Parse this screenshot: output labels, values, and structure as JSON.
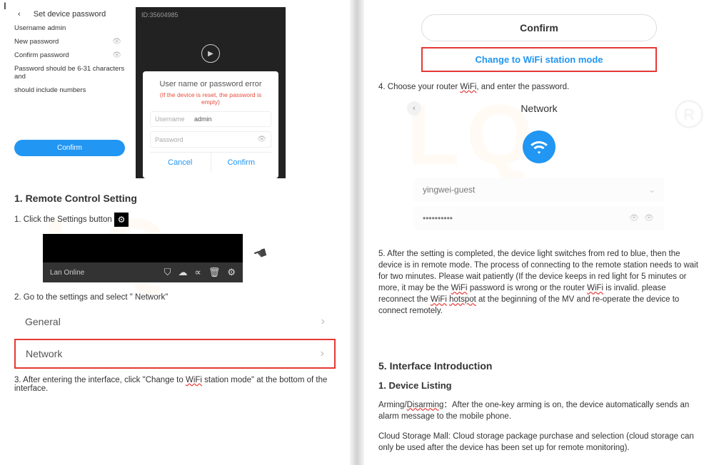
{
  "left": {
    "set_password_header": "Set device password",
    "username_admin": "Username admin",
    "new_password": "New password",
    "confirm_password": "Confirm password",
    "hint1": "Password should be 6-31 characters and",
    "hint2": "should include numbers",
    "confirm_btn": "Confirm",
    "id_label": "ID:35604985",
    "dialog_title": "User name or password error",
    "dialog_sub": "(If the device is reset, the password is empty)",
    "username_label": "Username",
    "username_value": "admin",
    "password_label": "Password",
    "cancel": "Cancel",
    "dlg_confirm": "Confirm",
    "section1": "1.  Remote Control Setting",
    "step1a": "1. Click the Settings button",
    "lan_online": "Lan  Online",
    "step2": "2. Go to the settings    and select \" Network\"",
    "menu_general": "General",
    "menu_network": "Network",
    "step3a": "3.   After entering the interface, click \"Change to ",
    "step3_wifi": "WiFi",
    "step3b": " station mode\" at the bottom of the interface."
  },
  "right": {
    "confirm_btn": "Confirm",
    "change_mode": "Change to WiFi station mode",
    "step4a": "4.    Choose your router ",
    "step4_wifi": "WiFi",
    "step4b": ", and enter the password.",
    "network_header": "Network",
    "ssid": "yingwei-guest",
    "dots": "••••••••••",
    "para5a": "5. After the setting is completed, the device light switches from red to blue, then the device is in remote mode. The process of connecting to the remote station needs to wait for two minutes. Please wait patiently (If the device keeps in red light for 5 minutes or more, it may be the ",
    "wifi1": "WiFi",
    "para5b": " password is wrong or the router ",
    "wifi2": "WiFi",
    "para5c": " is invalid. please reconnect the ",
    "wifi3": "WiFi",
    "space": " ",
    "hotspot": "hotspot",
    "para5d": " at the beginning of the MV and re-operate the device to connect remotely.",
    "section5": "5. Interface Introduction",
    "section_dev": "1. Device Listing",
    "arm_a": "Arming/",
    "disarming": "Disarming",
    "arm_b": "：After the one-key arming is on, the device automatically sends an alarm message to the mobile phone.",
    "cloud": "Cloud Storage Mall: Cloud storage package purchase and selection (cloud storage can only be used after the device has been set up for remote monitoring)."
  }
}
